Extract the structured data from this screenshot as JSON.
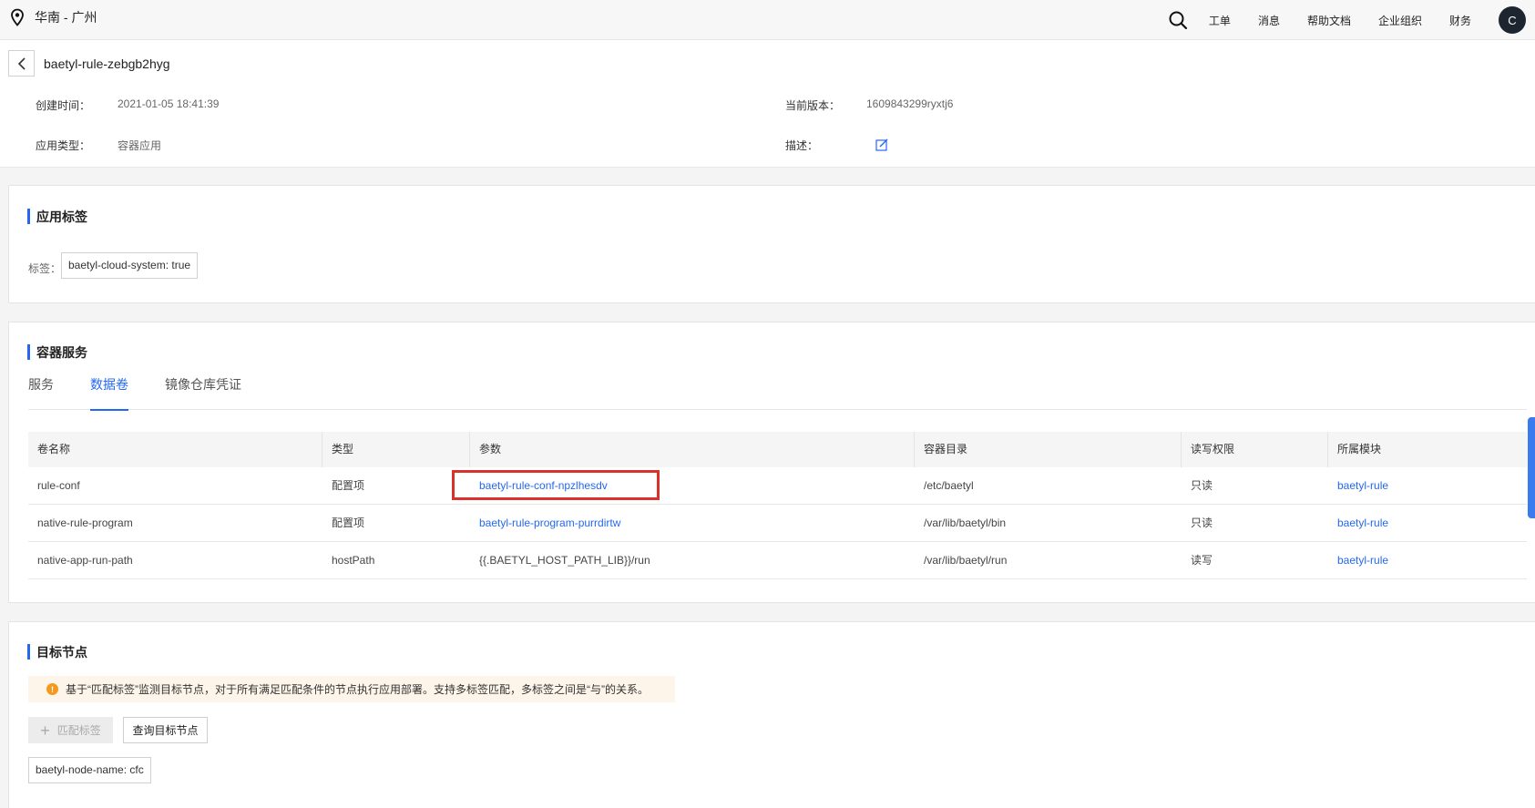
{
  "topbar": {
    "region": "华南 - 广州",
    "nav": [
      "工单",
      "消息",
      "帮助文档",
      "企业组织",
      "财务"
    ],
    "avatar": "C"
  },
  "header": {
    "title": "baetyl-rule-zebgb2hyg",
    "created_label": "创建时间：",
    "created_value": "2021-01-05 18:41:39",
    "version_label": "当前版本：",
    "version_value": "1609843299ryxtj6",
    "type_label": "应用类型：",
    "type_value": "容器应用",
    "desc_label": "描述："
  },
  "app_labels": {
    "title": "应用标签",
    "tag_label": "标签：",
    "tag_value": "baetyl-cloud-system: true"
  },
  "container_service": {
    "title": "容器服务",
    "tabs": [
      "服务",
      "数据卷",
      "镜像仓库凭证"
    ],
    "active_tab": "数据卷",
    "columns": [
      "卷名称",
      "类型",
      "参数",
      "容器目录",
      "读写权限",
      "所属模块"
    ],
    "rows": [
      {
        "name": "rule-conf",
        "type": "配置项",
        "param": "baetyl-rule-conf-npzlhesdv",
        "dir": "/etc/baetyl",
        "perm": "只读",
        "module": "baetyl-rule"
      },
      {
        "name": "native-rule-program",
        "type": "配置项",
        "param": "baetyl-rule-program-purrdirtw",
        "dir": "/var/lib/baetyl/bin",
        "perm": "只读",
        "module": "baetyl-rule"
      },
      {
        "name": "native-app-run-path",
        "type": "hostPath",
        "param": "{{.BAETYL_HOST_PATH_LIB}}/run",
        "dir": "/var/lib/baetyl/run",
        "perm": "读写",
        "module": "baetyl-rule"
      }
    ]
  },
  "target_nodes": {
    "title": "目标节点",
    "notice": "基于“匹配标签”监测目标节点，对于所有满足匹配条件的节点执行应用部署。支持多标签匹配，多标签之间是“与”的关系。",
    "match_button": "匹配标签",
    "query_button": "查询目标节点",
    "node_tag": "baetyl-node-name: cfc"
  },
  "colors": {
    "accent": "#2468f2",
    "highlight": "#d9322b",
    "warning": "#f39a1e"
  }
}
